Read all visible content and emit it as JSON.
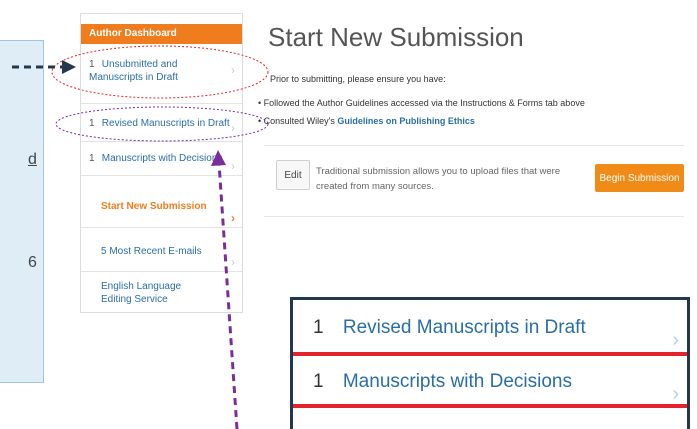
{
  "info_panel": {
    "fragments": [
      "d",
      "6"
    ]
  },
  "sidebar": {
    "header": "Author Dashboard",
    "items": [
      {
        "count": "1",
        "label": "Unsubmitted and Manuscripts in Draft"
      },
      {
        "count": "1",
        "label": "Revised Manuscripts in Draft"
      },
      {
        "count": "1",
        "label": "Manuscripts with Decisions"
      },
      {
        "count": "",
        "label": "Start New Submission"
      },
      {
        "count": "",
        "label": "5 Most Recent E-mails"
      },
      {
        "count": "",
        "label": "English Language Editing Service"
      }
    ]
  },
  "main": {
    "title": "Start New Submission",
    "prior_text": "Prior to submitting, please ensure you have:",
    "bullet1": "Followed the Author Guidelines accessed via the Instructions & Forms tab above",
    "bullet2_prefix": "Consulted Wiley's",
    "bullet2_link": "Guidelines on Publishing Ethics",
    "edit_label": "Edit",
    "description": "Traditional submission allows you to upload files that were created from many sources.",
    "begin_label": "Begin Submission"
  },
  "zoom": {
    "items": [
      {
        "count": "1",
        "label": "Revised Manuscripts in Draft"
      },
      {
        "count": "1",
        "label": "Manuscripts with Decisions"
      }
    ]
  },
  "colors": {
    "accent_orange": "#f07d1d",
    "link_blue": "#2a6ea6",
    "annotation_red": "#e5232b",
    "annotation_purple": "#7a2d9b",
    "annotation_navy": "#23384c"
  },
  "icons": [
    "chevron-right-icon",
    "arrow-right-icon",
    "arrow-up-icon"
  ]
}
